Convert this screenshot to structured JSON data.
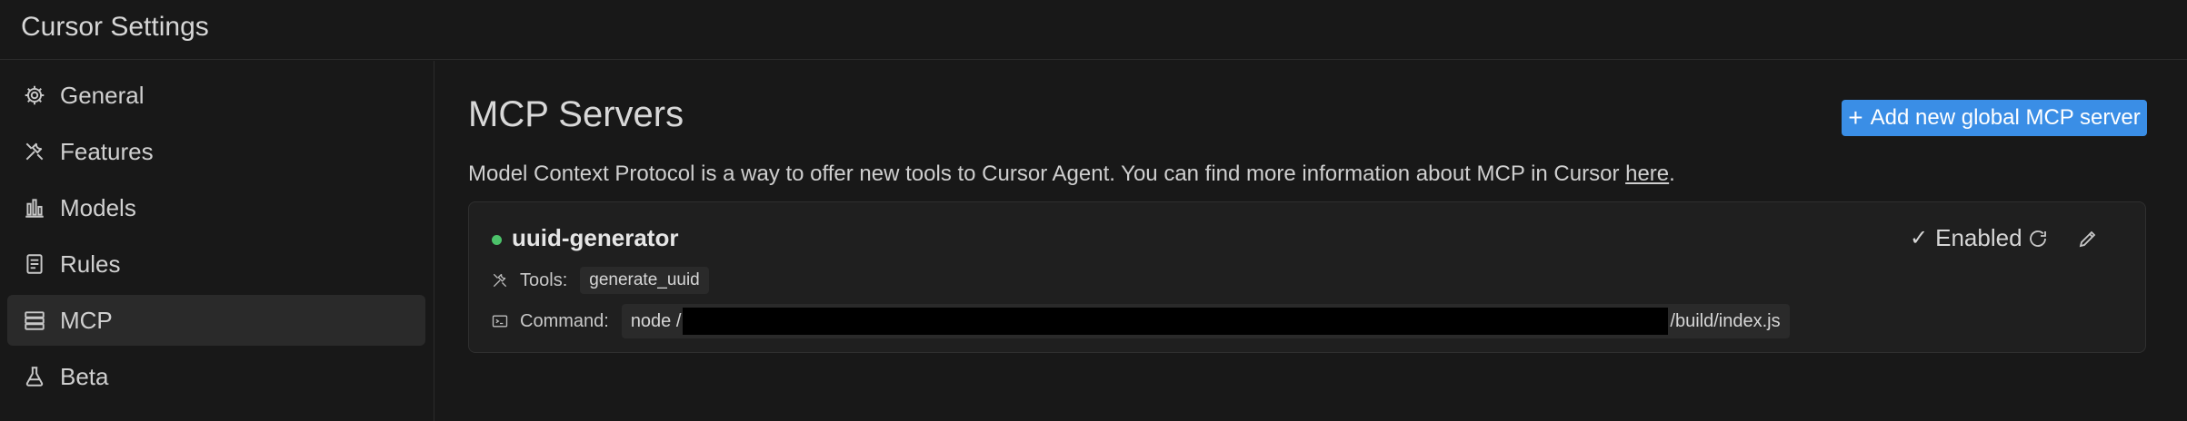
{
  "app": {
    "title": "Cursor Settings"
  },
  "sidebar": {
    "items": [
      {
        "label": "General",
        "icon": "gear-icon"
      },
      {
        "label": "Features",
        "icon": "tools-icon"
      },
      {
        "label": "Models",
        "icon": "bar-chart-icon"
      },
      {
        "label": "Rules",
        "icon": "document-icon"
      },
      {
        "label": "MCP",
        "icon": "server-icon",
        "active": true
      },
      {
        "label": "Beta",
        "icon": "flask-icon"
      }
    ]
  },
  "main": {
    "title": "MCP Servers",
    "add_button_label": "Add new global MCP server",
    "description_text": "Model Context Protocol is a way to offer new tools to Cursor Agent. You can find more information about MCP in Cursor ",
    "description_link": "here",
    "description_end": "."
  },
  "server": {
    "name": "uuid-generator",
    "status_color": "#4cc26a",
    "tools_label": "Tools:",
    "tools": [
      "generate_uuid"
    ],
    "command_label": "Command:",
    "command_prefix": "node /",
    "command_suffix": "/build/index.js",
    "enabled_label": "Enabled"
  },
  "colors": {
    "accent": "#3a8ee6",
    "background": "#181818"
  }
}
